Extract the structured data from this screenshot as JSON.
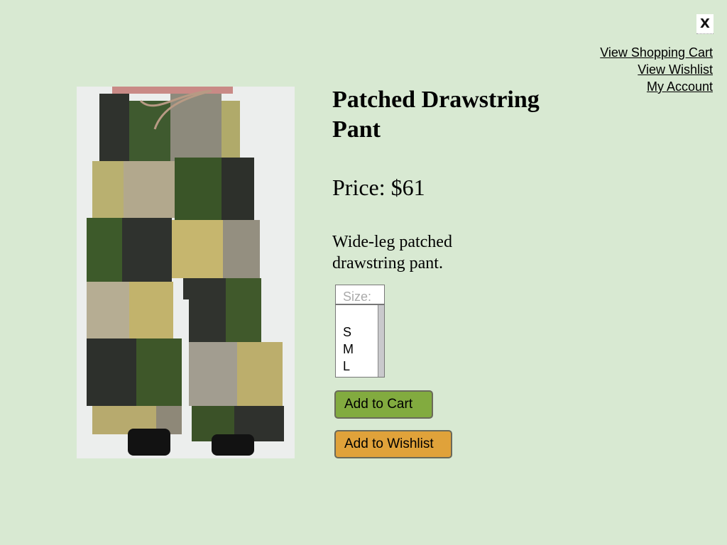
{
  "nav": {
    "close_label": "X",
    "links": [
      "View Shopping Cart",
      "View Wishlist",
      "My Account"
    ]
  },
  "product": {
    "title": "Patched Drawstring Pant",
    "price": "Price: $61",
    "description": "Wide-leg patched drawstring pant.",
    "size_label": "Size:",
    "sizes": [
      "S",
      "M",
      "L"
    ]
  },
  "actions": {
    "add_to_cart": "Add to Cart",
    "add_to_wishlist": "Add to Wishlist"
  },
  "colors": {
    "background": "#d8e9d2",
    "cart_button": "#82ab3f",
    "wishlist_button": "#e0a23a"
  },
  "icons": {
    "close": "close-icon"
  }
}
